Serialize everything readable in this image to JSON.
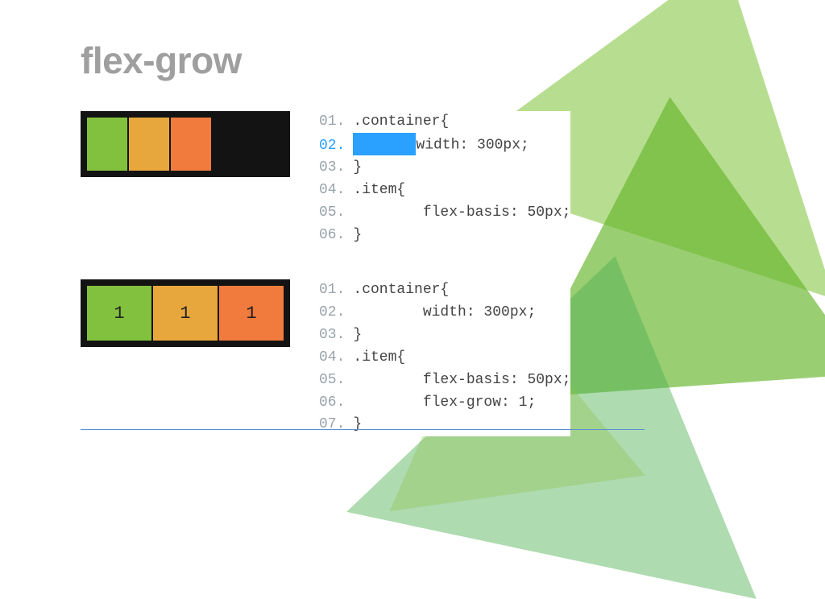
{
  "title": "flex-grow",
  "example1": {
    "boxLabels": [
      "",
      "",
      ""
    ],
    "code": [
      {
        "n": "01.",
        "t": ".container{",
        "highlight": false
      },
      {
        "n": "02.",
        "t": "        width: 300px;",
        "highlight": true
      },
      {
        "n": "03.",
        "t": "}",
        "highlight": false
      },
      {
        "n": "04.",
        "t": ".item{",
        "highlight": false
      },
      {
        "n": "05.",
        "t": "        flex-basis: 50px;",
        "highlight": false
      },
      {
        "n": "06.",
        "t": "}",
        "highlight": false
      }
    ]
  },
  "example2": {
    "boxLabels": [
      "1",
      "1",
      "1"
    ],
    "code": [
      {
        "n": "01.",
        "t": ".container{",
        "highlight": false
      },
      {
        "n": "02.",
        "t": "        width: 300px;",
        "highlight": false
      },
      {
        "n": "03.",
        "t": "}",
        "highlight": false
      },
      {
        "n": "04.",
        "t": ".item{",
        "highlight": false
      },
      {
        "n": "05.",
        "t": "        flex-basis: 50px;",
        "highlight": false
      },
      {
        "n": "06.",
        "t": "        flex-grow: 1;",
        "highlight": false
      },
      {
        "n": "07.",
        "t": "}",
        "highlight": false
      }
    ]
  }
}
